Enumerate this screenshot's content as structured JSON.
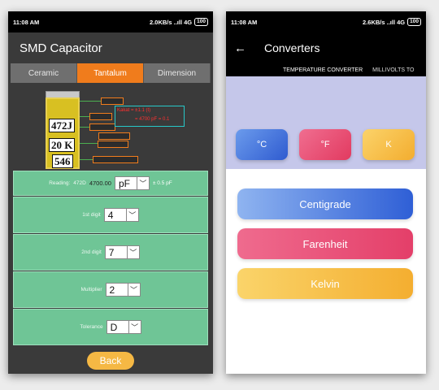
{
  "left": {
    "status": {
      "time": "11:08 AM",
      "network": "2.0KB/s ..ıll 4G",
      "battery": "100"
    },
    "title": "SMD Capacitor",
    "tabs": [
      {
        "label": "Ceramic",
        "active": false
      },
      {
        "label": "Tantalum",
        "active": true
      },
      {
        "label": "Dimension",
        "active": false
      }
    ],
    "diagram": {
      "codes": [
        "472J",
        "20 K",
        "546"
      ],
      "red_lines": [
        "Kakat = ±1.1 (t)",
        "= 4700 pF = 0.1"
      ]
    },
    "reading": {
      "label": "Reading:",
      "code": "472D",
      "value": "4700.00",
      "unit": "pF",
      "tolerance": "± 0.5 pF"
    },
    "rows": [
      {
        "label": "1st digit",
        "value": "4"
      },
      {
        "label": "2nd digit",
        "value": "7"
      },
      {
        "label": "Multiplier",
        "value": "2"
      },
      {
        "label": "Tolerance",
        "value": "D"
      }
    ],
    "back_label": "Back"
  },
  "right": {
    "status": {
      "time": "11:08 AM",
      "network": "2.6KB/s ..ıll 4G",
      "battery": "100"
    },
    "title": "Converters",
    "back_arrow": "←",
    "tabs": [
      "TEMPERATURE CONVERTER",
      "MILLIVOLTS TO"
    ],
    "units": [
      "°C",
      "°F",
      "K"
    ],
    "converters": [
      "Centigrade",
      "Farenheit",
      "Kelvin"
    ]
  },
  "colors": {
    "accent": "#f07c1c",
    "card_green": "#6fc596",
    "celsius": "#3b6fd8",
    "fahrenheit": "#e8476f",
    "kelvin": "#f5b844"
  },
  "icons": {
    "back": "arrow-left-icon",
    "dropdown": "chevron-down-icon"
  }
}
